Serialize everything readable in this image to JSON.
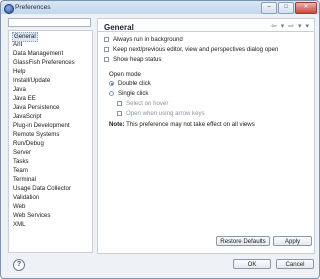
{
  "window": {
    "title": "Preferences",
    "buttons": [
      "–",
      "□",
      "✕"
    ]
  },
  "filter": {
    "placeholder": "",
    "value": ""
  },
  "tree": {
    "items": [
      "General",
      "Ant",
      "Data Management",
      "GlassFish Preferences",
      "Help",
      "Install/Update",
      "Java",
      "Java EE",
      "Java Persistence",
      "JavaScript",
      "Plug-in Development",
      "Remote Systems",
      "Run/Debug",
      "Server",
      "Tasks",
      "Team",
      "Terminal",
      "Usage Data Collector",
      "Validation",
      "Web",
      "Web Services",
      "XML"
    ],
    "selected": "General"
  },
  "page": {
    "heading": "General",
    "nav": "⇦ ▾ ⇨ ▾ ▾",
    "options": [
      {
        "label": "Always run in background",
        "checked": false
      },
      {
        "label": "Keep next/previous editor, view and perspectives dialog open",
        "checked": false
      },
      {
        "label": "Show heap status",
        "checked": false
      }
    ],
    "open_mode": {
      "label": "Open mode",
      "double_click": "Double click",
      "single_click": "Single click",
      "select_on_hover": "Select on hover",
      "open_arrow_keys": "Open when using arrow keys"
    },
    "note": {
      "bold": "Note:",
      "text": " This preference may not take effect on all views"
    },
    "restore_defaults": "Restore Defaults",
    "apply": "Apply"
  },
  "footer": {
    "ok": "OK",
    "cancel": "Cancel",
    "help_icon": "?"
  }
}
